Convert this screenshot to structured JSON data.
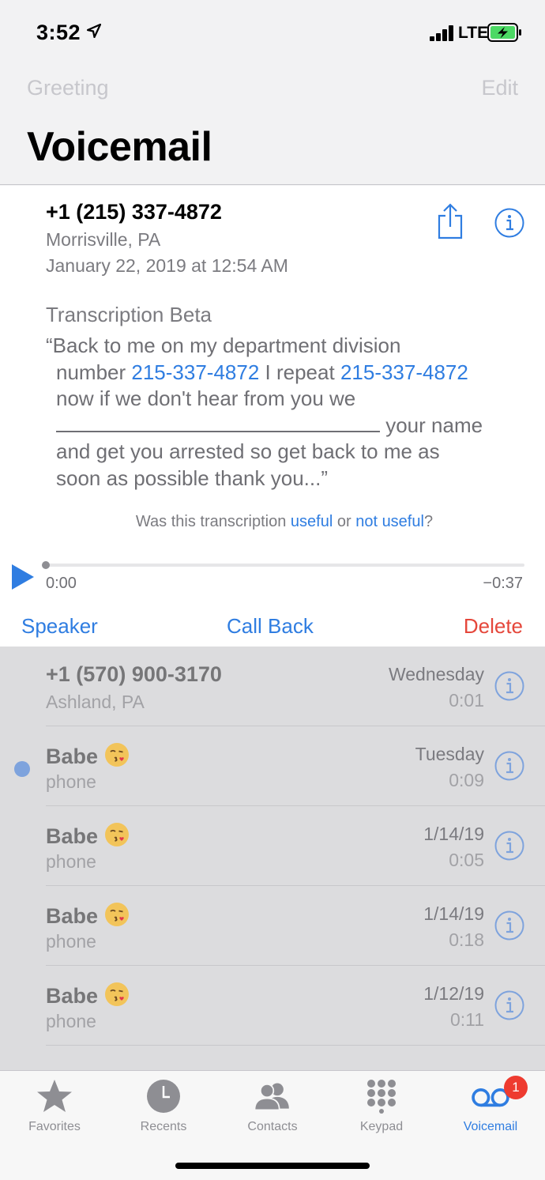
{
  "status_bar": {
    "time": "3:52",
    "network": "LTE"
  },
  "header": {
    "greeting_label": "Greeting",
    "edit_label": "Edit",
    "title": "Voicemail"
  },
  "selected": {
    "caller": "+1 (215) 337-4872",
    "location": "Morrisville, PA",
    "datetime": "January 22, 2019 at 12:54 AM",
    "transcription_title": "Transcription Beta",
    "transcription": {
      "line1": "“Back to me on my department division",
      "line2_a": "number ",
      "line2_num1": "215-337-4872",
      "line2_b": " I repeat ",
      "line2_num2": "215-337-4872",
      "line3": "now if we don't hear from you we",
      "line4_after_blank": " your name",
      "line5": "and get you arrested so get back to me as",
      "line6": "soon as possible thank you...”"
    },
    "feedback": {
      "prefix": "Was this transcription ",
      "useful": "useful",
      "middle": " or ",
      "not_useful": "not useful",
      "suffix": "?"
    },
    "elapsed": "0:00",
    "remaining": "−0:37",
    "progress": 0,
    "actions": {
      "speaker": "Speaker",
      "call_back": "Call Back",
      "delete": "Delete"
    }
  },
  "voicemails": [
    {
      "name": "+1 (570) 900-3170",
      "sub": "Ashland, PA",
      "date": "Wednesday",
      "duration": "0:01",
      "unread": false,
      "emoji": false
    },
    {
      "name": "Babe",
      "sub": "phone",
      "date": "Tuesday",
      "duration": "0:09",
      "unread": true,
      "emoji": true
    },
    {
      "name": "Babe",
      "sub": "phone",
      "date": "1/14/19",
      "duration": "0:05",
      "unread": false,
      "emoji": true
    },
    {
      "name": "Babe",
      "sub": "phone",
      "date": "1/14/19",
      "duration": "0:18",
      "unread": false,
      "emoji": true
    },
    {
      "name": "Babe",
      "sub": "phone",
      "date": "1/12/19",
      "duration": "0:11",
      "unread": false,
      "emoji": true
    }
  ],
  "tabs": [
    {
      "label": "Favorites",
      "icon": "star-icon"
    },
    {
      "label": "Recents",
      "icon": "clock-icon"
    },
    {
      "label": "Contacts",
      "icon": "contacts-icon"
    },
    {
      "label": "Keypad",
      "icon": "keypad-icon"
    },
    {
      "label": "Voicemail",
      "icon": "voicemail-icon",
      "badge": "1",
      "active": true
    }
  ],
  "colors": {
    "accent": "#2f7de1",
    "destructive": "#e5473b",
    "badge": "#ee3b30",
    "battery": "#4cd964"
  }
}
